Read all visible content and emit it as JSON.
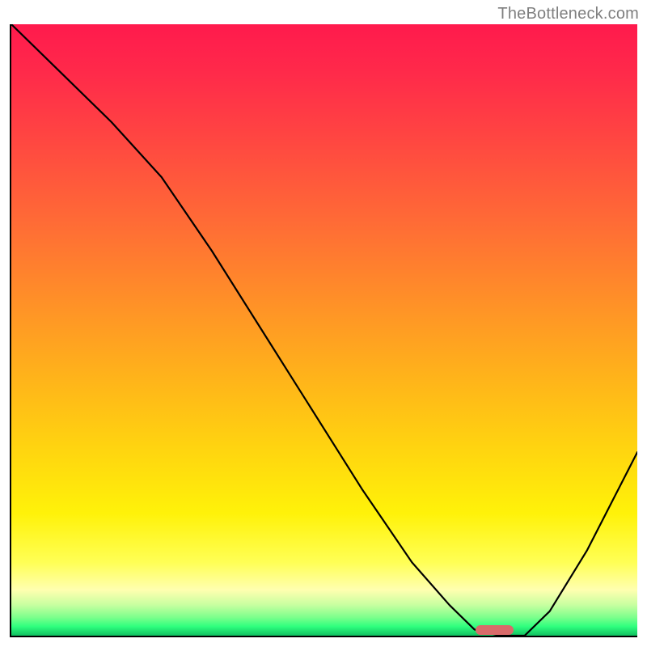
{
  "watermark": "TheBottleneck.com",
  "chart_data": {
    "type": "line",
    "title": "",
    "xlabel": "",
    "ylabel": "",
    "xlim": [
      0,
      100
    ],
    "ylim": [
      0,
      100
    ],
    "grid": false,
    "legend": false,
    "series": [
      {
        "name": "bottleneck-curve",
        "x": [
          0,
          8,
          16,
          24,
          32,
          40,
          48,
          56,
          64,
          70,
          74,
          78,
          82,
          86,
          92,
          100
        ],
        "y": [
          100,
          92,
          84,
          75,
          63,
          50,
          37,
          24,
          12,
          5,
          1,
          0,
          0,
          4,
          14,
          30
        ]
      }
    ],
    "marker": {
      "name": "optimal-range-bar",
      "x_start": 74,
      "x_end": 80,
      "color": "#d96a6a"
    },
    "background_gradient_stops": [
      {
        "pos_pct": 0,
        "color": "#ff1a4d"
      },
      {
        "pos_pct": 8,
        "color": "#ff2a4a"
      },
      {
        "pos_pct": 18,
        "color": "#ff4442"
      },
      {
        "pos_pct": 32,
        "color": "#ff6a36"
      },
      {
        "pos_pct": 45,
        "color": "#ff8f28"
      },
      {
        "pos_pct": 58,
        "color": "#ffb41a"
      },
      {
        "pos_pct": 70,
        "color": "#ffd60f"
      },
      {
        "pos_pct": 80,
        "color": "#fff209"
      },
      {
        "pos_pct": 88,
        "color": "#ffff55"
      },
      {
        "pos_pct": 92.5,
        "color": "#ffffb0"
      },
      {
        "pos_pct": 95,
        "color": "#c7ffa0"
      },
      {
        "pos_pct": 97,
        "color": "#7cff8c"
      },
      {
        "pos_pct": 98.5,
        "color": "#2fff7e"
      },
      {
        "pos_pct": 100,
        "color": "#10c060"
      }
    ]
  }
}
